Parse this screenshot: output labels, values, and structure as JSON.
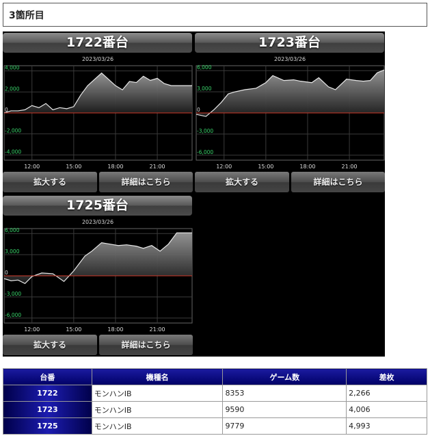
{
  "section_title": "3箇所目",
  "button_labels": {
    "zoom": "拡大する",
    "detail": "詳細はこちら"
  },
  "machines": [
    {
      "title": "1722番台",
      "date": "2023/03/26"
    },
    {
      "title": "1723番台",
      "date": "2023/03/26"
    },
    {
      "title": "1725番台",
      "date": "2023/03/26"
    }
  ],
  "chart_data": [
    {
      "type": "area",
      "title": "1722番台",
      "subtitle": "2023/03/26",
      "x_ticks": [
        "12:00",
        "15:00",
        "18:00",
        "21:00"
      ],
      "y_ticks": [
        "4,000",
        "2,000",
        "0",
        "-2,000",
        "-4,000"
      ],
      "ylim": [
        -4500,
        4500
      ],
      "xlim": [
        10,
        23.5
      ],
      "grid": true,
      "x": [
        10.0,
        10.5,
        11.0,
        11.5,
        12.0,
        12.5,
        13.0,
        13.5,
        14.0,
        14.5,
        15.0,
        15.5,
        16.0,
        16.5,
        17.0,
        17.5,
        18.0,
        18.5,
        19.0,
        19.5,
        20.0,
        20.5,
        21.0,
        21.5,
        22.0,
        22.5,
        23.0,
        23.5
      ],
      "values": [
        0,
        200,
        200,
        300,
        700,
        500,
        900,
        300,
        500,
        400,
        600,
        1700,
        2600,
        3200,
        3800,
        3200,
        2600,
        2200,
        3000,
        2900,
        3500,
        3100,
        3300,
        2800,
        2600,
        2600,
        2600,
        2600
      ]
    },
    {
      "type": "area",
      "title": "1723番台",
      "subtitle": "2023/03/26",
      "x_ticks": [
        "12:00",
        "15:00",
        "18:00",
        "21:00"
      ],
      "y_ticks": [
        "6,000",
        "3,000",
        "0",
        "-3,000",
        "-6,000"
      ],
      "ylim": [
        -6700,
        6700
      ],
      "xlim": [
        10,
        23.5
      ],
      "grid": true,
      "x": [
        10.0,
        10.7,
        11.3,
        11.8,
        12.3,
        12.8,
        13.5,
        14.3,
        15.0,
        15.5,
        16.3,
        17.0,
        17.5,
        18.3,
        18.8,
        19.5,
        20.0,
        20.8,
        21.5,
        22.0,
        22.5,
        23.0,
        23.5
      ],
      "values": [
        -200,
        -500,
        500,
        1500,
        2700,
        3000,
        3300,
        3500,
        4300,
        5300,
        4600,
        4700,
        4500,
        4300,
        5000,
        3700,
        3300,
        4800,
        4600,
        4500,
        4600,
        5700,
        6100
      ]
    },
    {
      "type": "area",
      "title": "1725番台",
      "subtitle": "2023/03/26",
      "x_ticks": [
        "12:00",
        "15:00",
        "18:00",
        "21:00"
      ],
      "y_ticks": [
        "6,000",
        "3,000",
        "0",
        "-3,000",
        "-6,000"
      ],
      "ylim": [
        -6700,
        6700
      ],
      "xlim": [
        10,
        23.5
      ],
      "grid": true,
      "x": [
        10.0,
        10.5,
        11.0,
        11.5,
        12.0,
        12.7,
        13.5,
        14.3,
        15.0,
        15.8,
        16.3,
        17.0,
        17.6,
        18.2,
        18.8,
        19.5,
        20.0,
        20.6,
        21.2,
        21.8,
        22.4,
        23.0,
        23.5
      ],
      "values": [
        -400,
        -700,
        -600,
        -1100,
        -100,
        400,
        300,
        -800,
        700,
        2800,
        3500,
        4700,
        4500,
        4300,
        4400,
        4200,
        3900,
        4300,
        3500,
        4500,
        6100,
        6100,
        6100
      ]
    }
  ],
  "table": {
    "headers": [
      "台番",
      "機種名",
      "ゲーム数",
      "差枚"
    ],
    "rows": [
      {
        "number": "1722",
        "model": "モンハンIB",
        "games": "8353",
        "diff": "2,266"
      },
      {
        "number": "1723",
        "model": "モンハンIB",
        "games": "9590",
        "diff": "4,006"
      },
      {
        "number": "1725",
        "model": "モンハンIB",
        "games": "9779",
        "diff": "4,993"
      }
    ]
  }
}
